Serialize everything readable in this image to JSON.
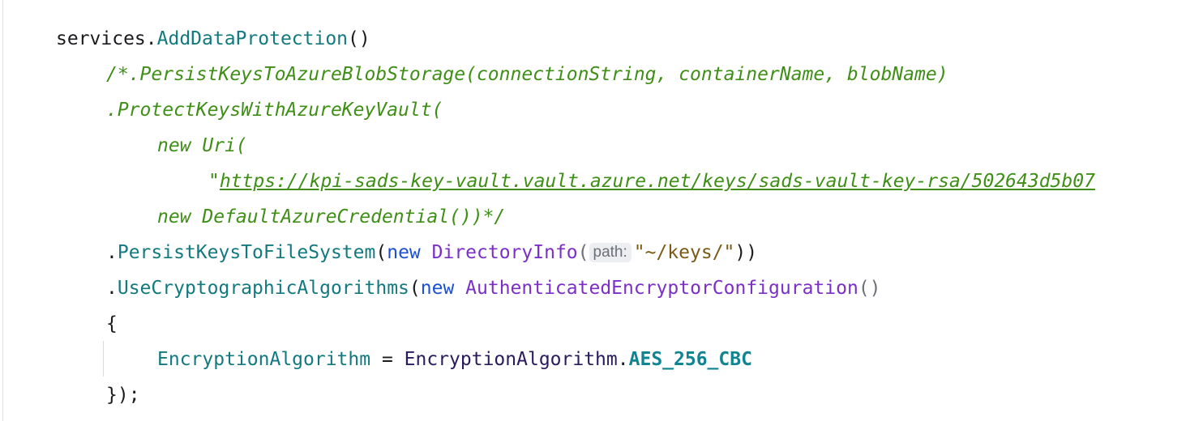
{
  "code": {
    "line1": {
      "obj": "services.",
      "method": "AddDataProtection",
      "parens": "()"
    },
    "line2": {
      "text": "/*.PersistKeysToAzureBlobStorage(connectionString, containerName, blobName)"
    },
    "line3": {
      "text": ".ProtectKeysWithAzureKeyVault("
    },
    "line4": {
      "text": "new Uri("
    },
    "line5": {
      "quote": "\"",
      "url": "https://kpi-sads-key-vault.vault.azure.net/keys/sads-vault-key-rsa/502643d5b07"
    },
    "line6": {
      "text": "new DefaultAzureCredential())*/"
    },
    "line7": {
      "dot": ".",
      "method": "PersistKeysToFileSystem",
      "open": "(",
      "keyword": "new",
      "type": "DirectoryInfo",
      "open2": "(",
      "hint": "path:",
      "string": "\"~/keys/\"",
      "close": "))"
    },
    "line8": {
      "dot": ".",
      "method": "UseCryptographicAlgorithms",
      "open": "(",
      "keyword": "new",
      "type": "AuthenticatedEncryptorConfiguration",
      "parens": "()"
    },
    "line9": {
      "text": "{"
    },
    "line10": {
      "prop": "EncryptionAlgorithm",
      "eq": " = ",
      "enum_type": "EncryptionAlgorithm",
      "dot": ".",
      "enum_value": "AES_256_CBC"
    },
    "line11": {
      "text": "});"
    }
  }
}
